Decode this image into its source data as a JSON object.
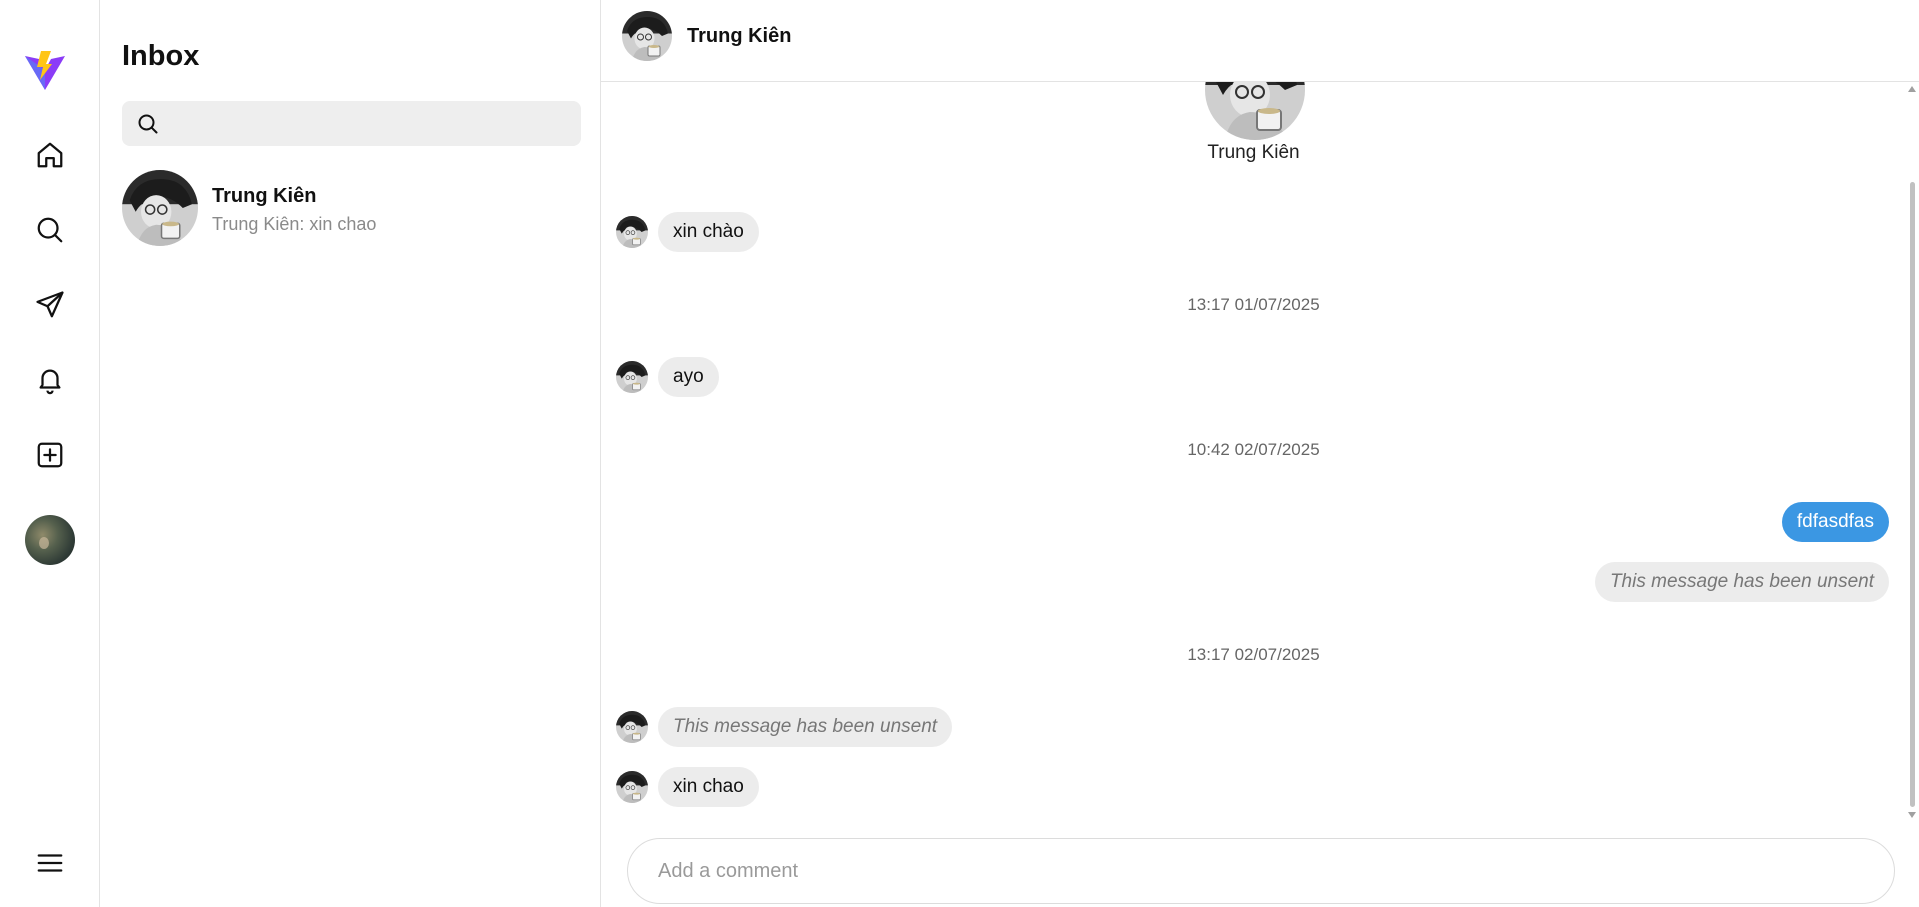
{
  "nav": {
    "items": [
      {
        "icon": "home-icon"
      },
      {
        "icon": "search-icon"
      },
      {
        "icon": "send-icon"
      },
      {
        "icon": "bell-icon"
      },
      {
        "icon": "plus-square-icon"
      }
    ],
    "menu_icon": "menu-icon",
    "logo_colors": {
      "primary": "#8b3cf7",
      "accent": "#ffc517"
    }
  },
  "inbox": {
    "title": "Inbox",
    "search_placeholder": "",
    "conversations": [
      {
        "name": "Trung Kiên",
        "preview": "Trung Kiên: xin chao"
      }
    ]
  },
  "chat": {
    "header_name": "Trung Kiên",
    "profile_name": "Trung Kiên",
    "messages": [
      {
        "type": "received",
        "text": "xin chào"
      },
      {
        "type": "timestamp",
        "text": "13:17 01/07/2025"
      },
      {
        "type": "received",
        "text": "ayo"
      },
      {
        "type": "timestamp",
        "text": "10:42 02/07/2025"
      },
      {
        "type": "sent",
        "text": "fdfasdfas"
      },
      {
        "type": "sent_unsent",
        "text": "This message has been unsent"
      },
      {
        "type": "timestamp",
        "text": "13:17 02/07/2025"
      },
      {
        "type": "received_unsent",
        "text": "This message has been unsent"
      },
      {
        "type": "received",
        "text": "xin chao"
      }
    ],
    "composer_placeholder": "Add a comment",
    "colors": {
      "sent_bubble": "#3b97e3",
      "received_bubble": "#ececec"
    }
  }
}
